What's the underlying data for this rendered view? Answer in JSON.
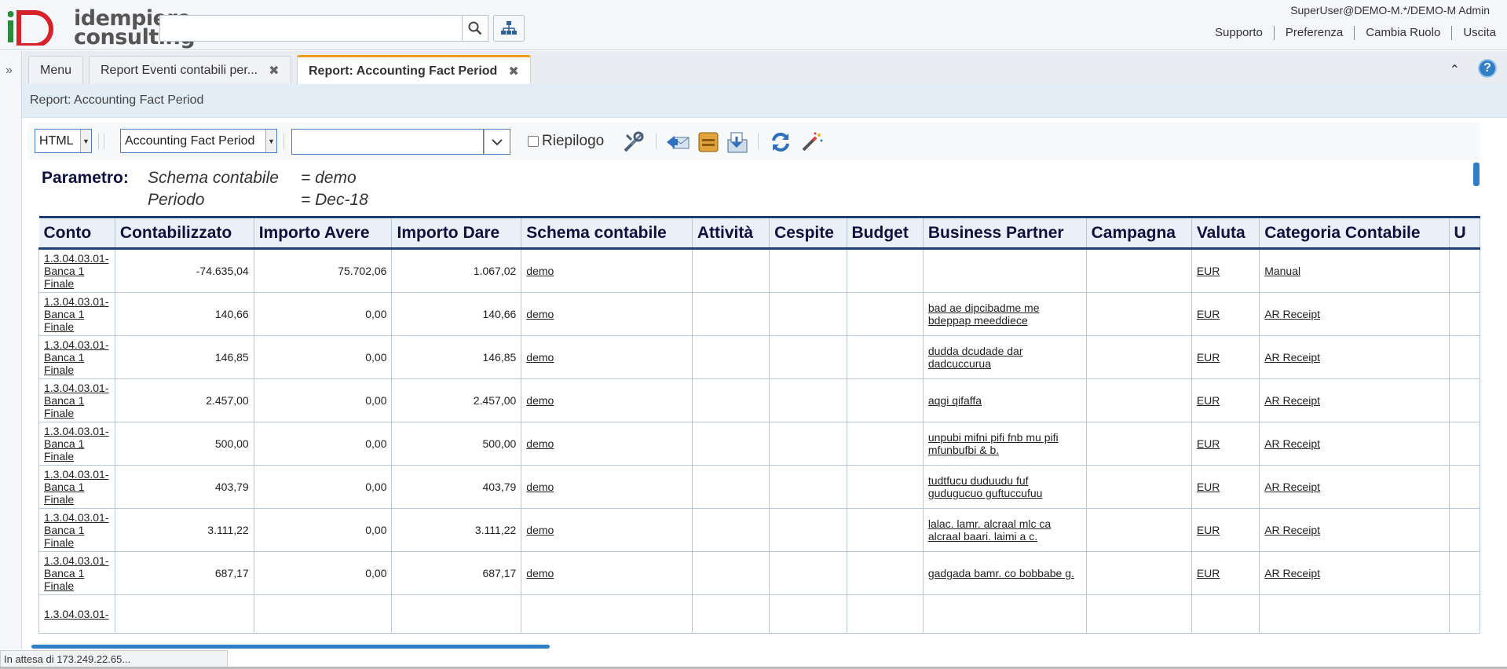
{
  "header": {
    "logo_word1": "idempiere",
    "logo_word2": "consulting",
    "search_placeholder": "",
    "user": "SuperUser@DEMO-M.*/DEMO-M Admin",
    "links": [
      "Supporto",
      "Preferenza",
      "Cambia Ruolo",
      "Uscita"
    ]
  },
  "tabs": [
    {
      "label": "Menu",
      "closable": false
    },
    {
      "label": "Report Eventi contabili per...",
      "closable": true
    },
    {
      "label": "Report: Accounting Fact Period",
      "closable": true,
      "active": true
    }
  ],
  "breadcrumb": "Report: Accounting Fact Period",
  "toolbar": {
    "format": "HTML",
    "print_format": "Accounting Fact Period",
    "combo_value": "",
    "summary_label": "Riepilogo",
    "summary_checked": false
  },
  "params": {
    "label": "Parametro:",
    "rows": [
      {
        "name": "Schema contabile",
        "value": "= demo"
      },
      {
        "name": "Periodo",
        "value": "= Dec-18"
      }
    ]
  },
  "table": {
    "columns": [
      "Conto",
      "Contabilizzato",
      "Importo Avere",
      "Importo Dare",
      "Schema contabile",
      "Attività",
      "Cespite",
      "Budget",
      "Business Partner",
      "Campagna",
      "Valuta",
      "Categoria Contabile",
      "U"
    ],
    "rows": [
      {
        "conto": "1.3.04.03.01-Banca 1 Finale",
        "contab": "-74.635,04",
        "avere": "75.702,06",
        "dare": "1.067,02",
        "schema": "demo",
        "bp": "",
        "valuta": "EUR",
        "categoria": "Manual"
      },
      {
        "conto": "1.3.04.03.01-Banca 1 Finale",
        "contab": "140,66",
        "avere": "0,00",
        "dare": "140,66",
        "schema": "demo",
        "bp": "bad ae dipcibadme me bdeppap meeddiece",
        "valuta": "EUR",
        "categoria": "AR Receipt"
      },
      {
        "conto": "1.3.04.03.01-Banca 1 Finale",
        "contab": "146,85",
        "avere": "0,00",
        "dare": "146,85",
        "schema": "demo",
        "bp": "dudda dcudade dar dadcuccurua",
        "valuta": "EUR",
        "categoria": "AR Receipt"
      },
      {
        "conto": "1.3.04.03.01-Banca 1 Finale",
        "contab": "2.457,00",
        "avere": "0,00",
        "dare": "2.457,00",
        "schema": "demo",
        "bp": "aqgi qifaffa",
        "valuta": "EUR",
        "categoria": "AR Receipt"
      },
      {
        "conto": "1.3.04.03.01-Banca 1 Finale",
        "contab": "500,00",
        "avere": "0,00",
        "dare": "500,00",
        "schema": "demo",
        "bp": "unpubi mifni pifi fnb mu pifi mfunbufbi & b.",
        "valuta": "EUR",
        "categoria": "AR Receipt"
      },
      {
        "conto": "1.3.04.03.01-Banca 1 Finale",
        "contab": "403,79",
        "avere": "0,00",
        "dare": "403,79",
        "schema": "demo",
        "bp": "tudtfucu duduudu fuf gudugucuo guftuccufuu",
        "valuta": "EUR",
        "categoria": "AR Receipt"
      },
      {
        "conto": "1.3.04.03.01-Banca 1 Finale",
        "contab": "3.111,22",
        "avere": "0,00",
        "dare": "3.111,22",
        "schema": "demo",
        "bp": "lalac. lamr. alcraal mlc ca alcraal baari. laimi a c.",
        "valuta": "EUR",
        "categoria": "AR Receipt"
      },
      {
        "conto": "1.3.04.03.01-Banca 1 Finale",
        "contab": "687,17",
        "avere": "0,00",
        "dare": "687,17",
        "schema": "demo",
        "bp": "gadgada bamr. co bobbabe g.",
        "valuta": "EUR",
        "categoria": "AR Receipt"
      },
      {
        "conto": "1.3.04.03.01-",
        "contab": "",
        "avere": "",
        "dare": "",
        "schema": "",
        "bp": "",
        "valuta": "",
        "categoria": ""
      }
    ]
  },
  "status": "In attesa di 173.249.22.65...",
  "colors": {
    "accent": "#2f7ec9",
    "tab_active_border": "#f19b1c",
    "header_navy": "#10103f"
  }
}
